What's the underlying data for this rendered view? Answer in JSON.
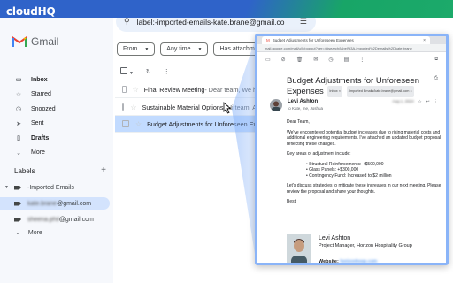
{
  "brand": {
    "cloudhq_logo": "cloudHQ"
  },
  "gmail": {
    "wordmark": "Gmail",
    "search": {
      "query": "label:-imported-emails-kate.brane@gmail.co"
    },
    "filters": [
      {
        "label": "From"
      },
      {
        "label": "Any time"
      },
      {
        "label": "Has attachme"
      }
    ],
    "nav": [
      {
        "label": "Inbox",
        "icon": "inbox-icon",
        "glyph": "▭"
      },
      {
        "label": "Starred",
        "icon": "star-icon",
        "glyph": "☆"
      },
      {
        "label": "Snoozed",
        "icon": "clock-icon",
        "glyph": "◷"
      },
      {
        "label": "Sent",
        "icon": "send-icon",
        "glyph": "➤"
      },
      {
        "label": "Drafts",
        "icon": "draft-icon",
        "glyph": "▯"
      },
      {
        "label": "More",
        "icon": "chevron-down-icon",
        "glyph": "⌄"
      }
    ],
    "labels_heading": "Labels",
    "labels": [
      {
        "label": "-Imported Emails"
      },
      {
        "label_hidden": "kate.brane",
        "label_visible": "@gmail.com"
      },
      {
        "label_hidden": "sheena.phil",
        "label_visible": "@gmail.com"
      }
    ],
    "labels_more": "More",
    "emails": [
      {
        "subject": "Final Review Meeting",
        "snippet": " - Dear team, We h"
      },
      {
        "subject": "Sustainable Material Options",
        "snippet": " - Hi team, A"
      },
      {
        "subject": "Budget Adjustments for Unforeseen Ex",
        "snippet": ""
      }
    ]
  },
  "popup": {
    "tab_title": "Budget Adjustments for Unforeseen Expenses",
    "url": "mail.google.com/mail/u/0/popout?ver=4#search/label%3A-imported%2Demails%2Dkate.brane",
    "subject": "Budget Adjustments for Unforeseen Expenses",
    "pills": [
      "Inbox ×",
      "-Imported Emails/kate.brane@gmail.com ×"
    ],
    "sender_name": "Levi Ashton",
    "sender_to": "to Kate, me, Joshua",
    "date": "Aug 1, 2024",
    "body": {
      "greeting": "Dear Team,",
      "p1": "We've encountered potential budget increases due to rising material costs and additional engineering requirements. I've attached an updated budget proposal reflecting these changes.",
      "p2": "Key areas of adjustment include:",
      "items": [
        "Structural Reinforcements: +$500,000",
        "Glass Panels: +$300,000",
        "Contingency Fund: Increased to $2 million"
      ],
      "p3": "Let's discuss strategies to mitigate these increases in our next meeting. Please review the proposal and share your thoughts.",
      "closing": "Best,"
    },
    "signature": {
      "name": "Levi Ashton",
      "role": "Project Manager, Horizon Hospitality Group",
      "website_label": "Website:",
      "website_hidden": "horizonhosp.com"
    }
  },
  "colors": {
    "accent": "#2f63c9",
    "green": "#1fae6d",
    "selected_row": "#c2dbff",
    "popup_border": "#8ab4f8"
  }
}
